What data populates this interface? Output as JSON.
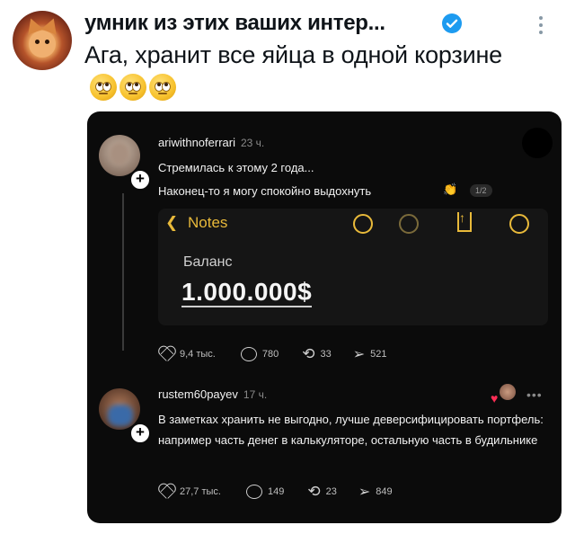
{
  "tweet": {
    "author_name": "умник из этих ваших интер...",
    "text": "Ага, хранит все яйца в одной корзине",
    "emoji": [
      "face-with-rolling-eyes",
      "face-with-rolling-eyes",
      "face-with-rolling-eyes"
    ]
  },
  "screenshot": {
    "post": {
      "username": "ariwithnoferrari",
      "time": "23 ч.",
      "line1": "Стремилась к этому 2 года...",
      "line2": "Наконец-то я могу спокойно выдохнуть",
      "pager": "1/2",
      "notes": {
        "back_label": "Notes",
        "balance_label": "Баланс",
        "balance_value": "1.000.000$"
      },
      "stats": {
        "likes": "9,4 тыс.",
        "comments": "780",
        "reposts": "33",
        "shares": "521"
      }
    },
    "reply": {
      "username": "rustem60payev",
      "time": "17 ч.",
      "text": "В заметках хранить не выгодно, лучше деверсифицировать портфель: например часть денег в калькуляторе, остальную часть в будильнике",
      "stats": {
        "likes": "27,7 тыс.",
        "comments": "149",
        "reposts": "23",
        "shares": "849"
      }
    }
  },
  "colors": {
    "notes_accent": "#e8b93a",
    "verified": "#1d9bf0",
    "card_bg": "#0b0b0b"
  }
}
